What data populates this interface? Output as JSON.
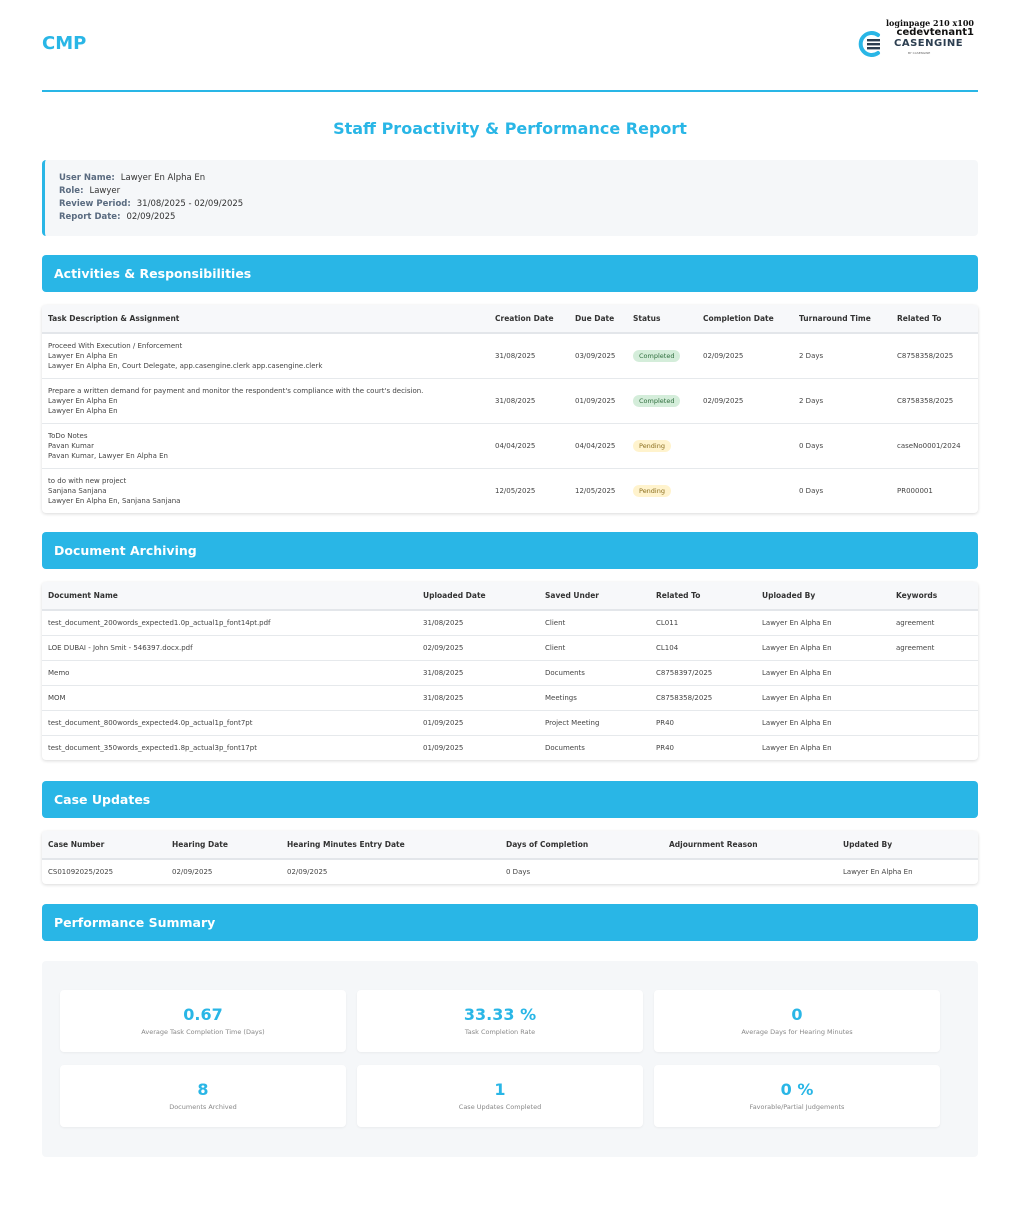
{
  "header": {
    "brand": "CMP",
    "logo_top_text": "loginpage 210 x100",
    "tenant": "cedevtenant1",
    "logo_word": "CASENGINE",
    "logo_sub": "BY CASENGINE",
    "accent_color": "#29b6e6"
  },
  "report": {
    "title": "Staff Proactivity & Performance Report",
    "info": [
      {
        "label": "User Name:",
        "value": "Lawyer En Alpha En"
      },
      {
        "label": "Role:",
        "value": "Lawyer"
      },
      {
        "label": "Review Period:",
        "value": "31/08/2025 - 02/09/2025"
      },
      {
        "label": "Report Date:",
        "value": "02/09/2025"
      }
    ]
  },
  "activities": {
    "heading": "Activities & Responsibilities",
    "columns": [
      "Task Description & Assignment",
      "Creation Date",
      "Due Date",
      "Status",
      "Completion Date",
      "Turnaround Time",
      "Related To"
    ],
    "rows": [
      {
        "lines": [
          "Proceed With Execution / Enforcement",
          "Lawyer En Alpha En",
          "Lawyer En Alpha En, Court Delegate, app.casengine.clerk app.casengine.clerk"
        ],
        "creation": "31/08/2025",
        "due": "03/09/2025",
        "status": "Completed",
        "status_kind": "completed",
        "completion": "02/09/2025",
        "turnaround": "2 Days",
        "related": "C8758358/2025"
      },
      {
        "lines": [
          "Prepare a written demand for payment and monitor the respondent's compliance with the court's decision.",
          "Lawyer En Alpha En",
          "Lawyer En Alpha En"
        ],
        "creation": "31/08/2025",
        "due": "01/09/2025",
        "status": "Completed",
        "status_kind": "completed",
        "completion": "02/09/2025",
        "turnaround": "2 Days",
        "related": "C8758358/2025"
      },
      {
        "lines": [
          "ToDo Notes",
          "Pavan Kumar",
          "Pavan Kumar, Lawyer En Alpha En"
        ],
        "creation": "04/04/2025",
        "due": "04/04/2025",
        "status": "Pending",
        "status_kind": "pending",
        "completion": "",
        "turnaround": "0 Days",
        "related": "caseNo0001/2024"
      },
      {
        "lines": [
          "to do with new project",
          "Sanjana Sanjana",
          "Lawyer En Alpha En, Sanjana Sanjana"
        ],
        "creation": "12/05/2025",
        "due": "12/05/2025",
        "status": "Pending",
        "status_kind": "pending",
        "completion": "",
        "turnaround": "0 Days",
        "related": "PR000001"
      }
    ]
  },
  "documents": {
    "heading": "Document Archiving",
    "columns": [
      "Document Name",
      "Uploaded Date",
      "Saved Under",
      "Related To",
      "Uploaded By",
      "Keywords"
    ],
    "rows": [
      [
        "test_document_200words_expected1.0p_actual1p_font14pt.pdf",
        "31/08/2025",
        "Client",
        "CL011",
        "Lawyer En Alpha En",
        "agreement"
      ],
      [
        "LOE DUBAI - John Smit - 546397.docx.pdf",
        "02/09/2025",
        "Client",
        "CL104",
        "Lawyer En Alpha En",
        "agreement"
      ],
      [
        "Memo",
        "31/08/2025",
        "Documents",
        "C8758397/2025",
        "Lawyer En Alpha En",
        ""
      ],
      [
        "MOM",
        "31/08/2025",
        "Meetings",
        "C8758358/2025",
        "Lawyer En Alpha En",
        ""
      ],
      [
        "test_document_800words_expected4.0p_actual1p_font7pt",
        "01/09/2025",
        "Project Meeting",
        "PR40",
        "Lawyer En Alpha En",
        ""
      ],
      [
        "test_document_350words_expected1.8p_actual3p_font17pt",
        "01/09/2025",
        "Documents",
        "PR40",
        "Lawyer En Alpha En",
        ""
      ]
    ]
  },
  "case_updates": {
    "heading": "Case Updates",
    "columns": [
      "Case Number",
      "Hearing Date",
      "Hearing Minutes Entry Date",
      "Days of Completion",
      "Adjournment Reason",
      "Updated By"
    ],
    "rows": [
      [
        "CS01092025/2025",
        "02/09/2025",
        "02/09/2025",
        "0 Days",
        "",
        "Lawyer En Alpha En"
      ]
    ]
  },
  "performance": {
    "heading": "Performance Summary",
    "metrics": [
      {
        "value": "0.67",
        "label": "Average Task Completion Time (Days)"
      },
      {
        "value": "33.33 %",
        "label": "Task Completion Rate"
      },
      {
        "value": "0",
        "label": "Average Days for Hearing Minutes"
      },
      {
        "value": "8",
        "label": "Documents Archived"
      },
      {
        "value": "1",
        "label": "Case Updates Completed"
      },
      {
        "value": "0 %",
        "label": "Favorable/Partial Judgements"
      }
    ]
  }
}
